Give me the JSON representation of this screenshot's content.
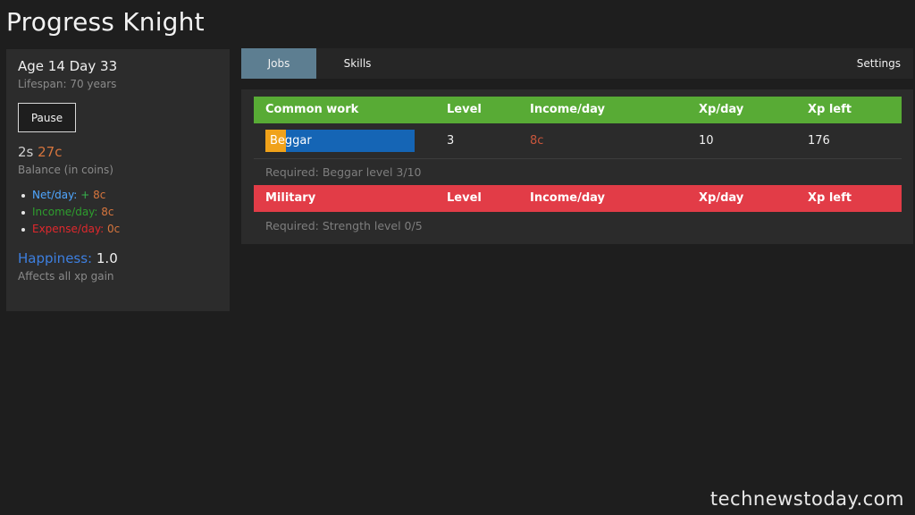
{
  "app": {
    "title": "Progress Knight"
  },
  "status": {
    "age_line": "Age 14 Day 33",
    "lifespan": "Lifespan: 70 years",
    "pause_label": "Pause",
    "balance_silver": "2s",
    "balance_copper": "27c",
    "balance_label": "Balance (in coins)",
    "net_label": "Net/day:",
    "net_plus": "+",
    "net_value": "8c",
    "income_label": "Income/day:",
    "income_value": "8c",
    "expense_label": "Expense/day:",
    "expense_value": "0c",
    "happiness_label": "Happiness:",
    "happiness_value": "1.0",
    "happiness_note": "Affects all xp gain"
  },
  "tabs": [
    {
      "label": "Jobs",
      "active": true
    },
    {
      "label": "Skills",
      "active": false
    },
    {
      "label": "Settings",
      "active": false
    }
  ],
  "jobs": {
    "categories": [
      {
        "name": "Common work",
        "color": "#58ab35",
        "columns": [
          "Level",
          "Income/day",
          "Xp/day",
          "Xp left"
        ],
        "rows": [
          {
            "name": "Beggar",
            "level": "3",
            "income": "8c",
            "xp_per_day": "10",
            "xp_left": "176",
            "progress_fraction": 0.14,
            "bar_color": "#1565b5",
            "fill_color": "#f0a21a"
          }
        ],
        "requirement": "Required: Beggar level 3/10"
      },
      {
        "name": "Military",
        "color": "#e23c47",
        "columns": [
          "Level",
          "Income/day",
          "Xp/day",
          "Xp left"
        ],
        "rows": [],
        "requirement": "Required: Strength level 0/5"
      }
    ]
  },
  "watermark": "technewstoday.com"
}
